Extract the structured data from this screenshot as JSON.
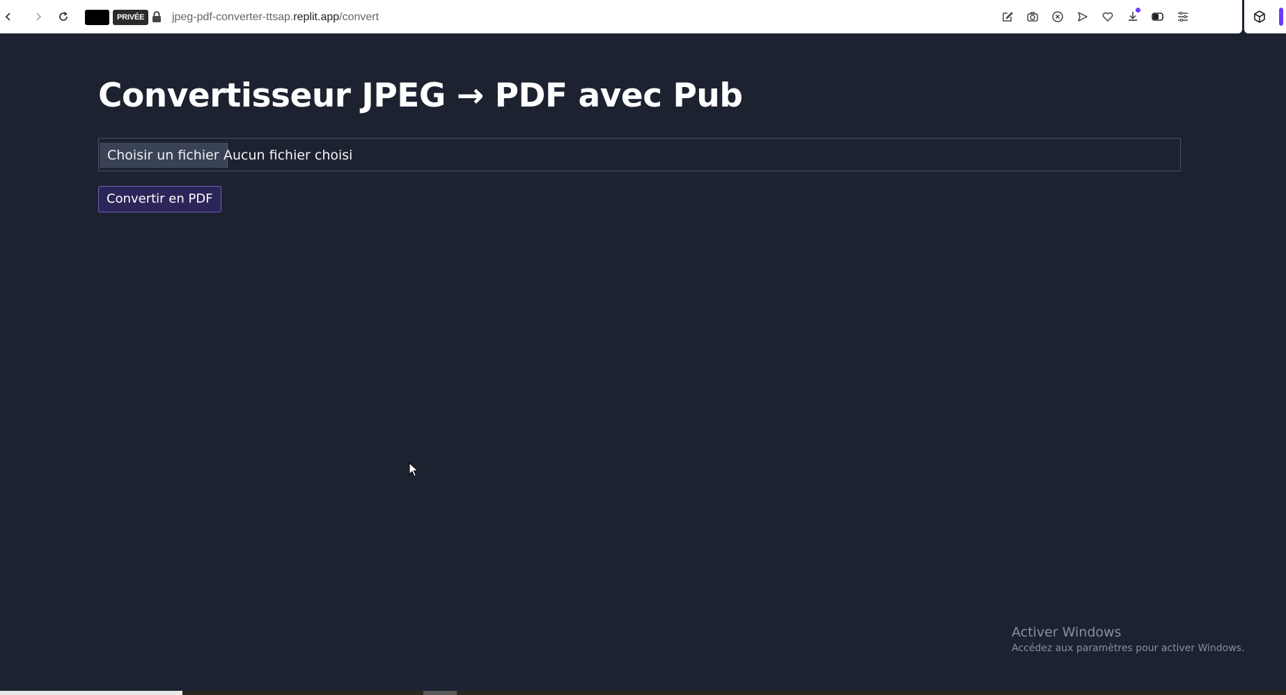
{
  "browser": {
    "private_label": "PRIVÉE",
    "url_host": "jpeg-pdf-converter-ttsap.replit.app",
    "url_path": "/convert",
    "url_prefix": "jpeg-pdf-converter-ttsap.",
    "url_domain": "replit.app",
    "toolbar_icons": [
      "edit-icon",
      "camera-icon",
      "close-circle-icon",
      "send-icon",
      "heart-icon",
      "download-icon",
      "battery-icon",
      "menu-icon"
    ],
    "accent_color": "#6c3bff"
  },
  "main": {
    "title": "Convertisseur JPEG → PDF avec Pub",
    "file_button_label": "Choisir un fichier",
    "file_status": "Aucun fichier choisi",
    "convert_button_label": "Convertir en PDF"
  },
  "watermark": {
    "title": "Activer Windows",
    "subtitle": "Accédez aux paramètres pour activer Windows."
  },
  "colors": {
    "page_background": "#1d2231",
    "convert_button_bg": "#2c2658",
    "file_button_bg": "#3a4256"
  }
}
